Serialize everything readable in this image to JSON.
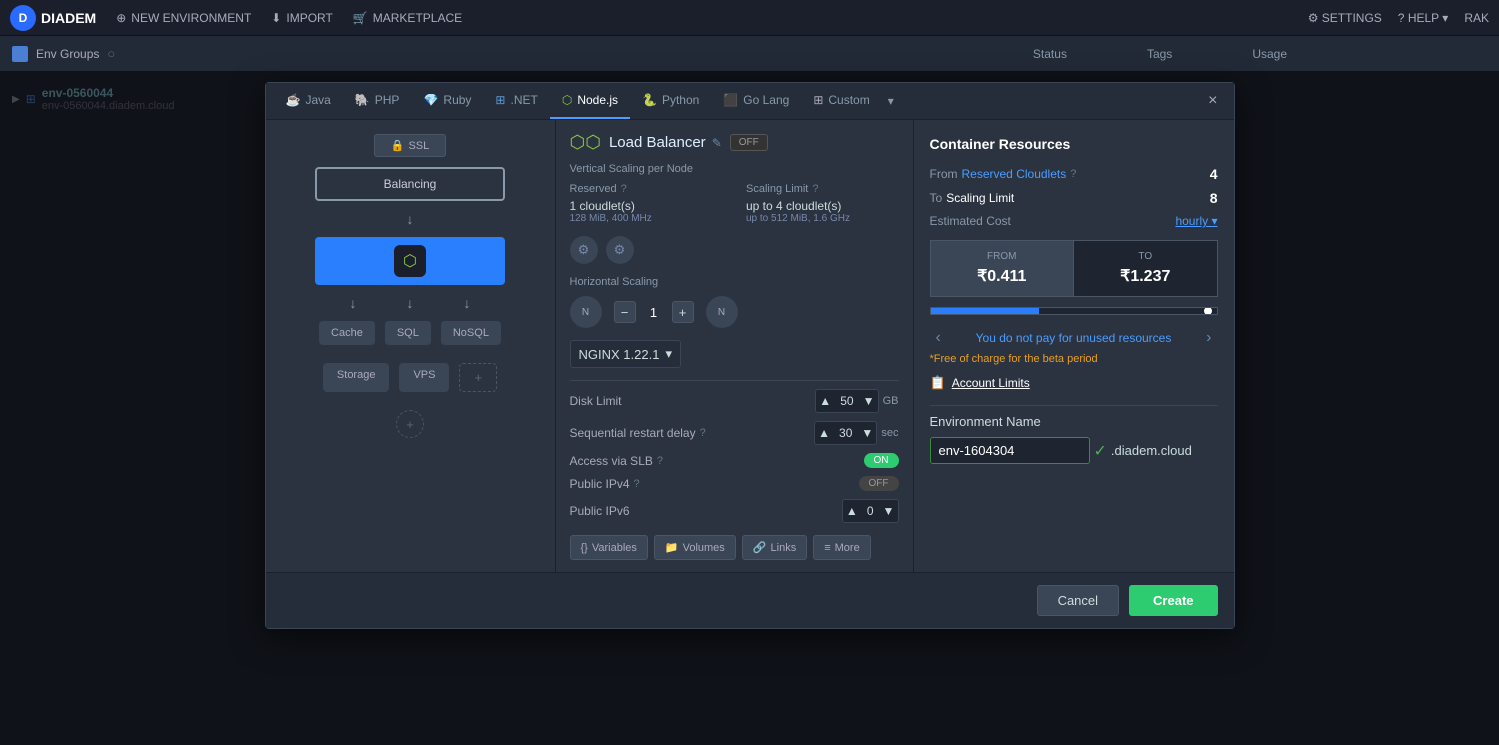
{
  "app": {
    "logo": "D",
    "brand": "DIADEM"
  },
  "topnav": {
    "items": [
      {
        "label": "NEW ENVIRONMENT",
        "icon": "plus-icon"
      },
      {
        "label": "IMPORT",
        "icon": "import-icon"
      },
      {
        "label": "MARKETPLACE",
        "icon": "marketplace-icon"
      }
    ],
    "right": [
      {
        "label": "SETTINGS",
        "icon": "settings-icon"
      },
      {
        "label": "HELP",
        "icon": "help-icon"
      },
      {
        "label": "RAK",
        "icon": "user-icon"
      }
    ]
  },
  "breadcrumb": {
    "group": "Env Groups",
    "columns": [
      "Status",
      "Tags",
      "Usage"
    ]
  },
  "sidebar": {
    "env_name": "env-0560044",
    "env_url": "env-0560044.diadem.cloud"
  },
  "modal": {
    "tabs": [
      {
        "label": "Java",
        "icon": "☕",
        "active": false
      },
      {
        "label": "PHP",
        "icon": "🐘",
        "active": false
      },
      {
        "label": "Ruby",
        "icon": "💎",
        "active": false
      },
      {
        "label": ".NET",
        "icon": "⊞",
        "active": false
      },
      {
        "label": "Node.js",
        "icon": "⬡",
        "active": true
      },
      {
        "label": "Python",
        "icon": "🐍",
        "active": false
      },
      {
        "label": "Go Lang",
        "icon": "🐹",
        "active": false
      },
      {
        "label": "Custom",
        "icon": "⊞",
        "active": false
      }
    ],
    "close_label": "×",
    "topology": {
      "ssl_label": "SSL",
      "balancing_label": "Balancing",
      "node_icon": "⬡",
      "db_items": [
        "Cache",
        "SQL",
        "NoSQL"
      ],
      "storage_items": [
        "Storage",
        "VPS"
      ],
      "add_more": "+"
    },
    "config": {
      "load_balancer_title": "Load Balancer",
      "edit_icon": "✎",
      "toggle_label": "OFF",
      "vertical_scaling_label": "Vertical Scaling per Node",
      "reserved_label": "Reserved",
      "reserved_help": "?",
      "scaling_limit_label": "Scaling Limit",
      "scaling_limit_help": "?",
      "reserved_val": "1",
      "reserved_unit": "cloudlet(s)",
      "reserved_sub": "128 MiB, 400 MHz",
      "scaling_val": "up to 4",
      "scaling_unit": "cloudlet(s)",
      "scaling_sub": "up to 512 MiB, 1.6 GHz",
      "horizontal_scaling_label": "Horizontal Scaling",
      "hz_count": "1",
      "nginx_version": "NGINX 1.22.1",
      "disk_limit_label": "Disk Limit",
      "disk_limit_val": "50",
      "disk_limit_unit": "GB",
      "seq_restart_label": "Sequential restart delay",
      "seq_restart_help": "?",
      "seq_restart_val": "30",
      "seq_restart_unit": "sec",
      "access_slb_label": "Access via SLB",
      "access_slb_help": "?",
      "access_slb_toggle": "ON",
      "public_ipv4_label": "Public IPv4",
      "public_ipv4_help": "?",
      "public_ipv4_toggle": "OFF",
      "public_ipv6_label": "Public IPv6",
      "public_ipv6_val": "0",
      "tools": [
        "Variables",
        "Volumes",
        "Links",
        "More"
      ]
    },
    "resources": {
      "title": "Container Resources",
      "from_label": "From",
      "reserved_cloudlets_label": "Reserved Cloudlets",
      "reserved_cloudlets_val": "4",
      "to_label": "To",
      "scaling_limit_label": "Scaling Limit",
      "scaling_limit_val": "8",
      "estimated_label": "Estimated Cost",
      "hourly_label": "hourly",
      "from_cost_label": "FROM",
      "from_cost_val": "₹0.411",
      "to_cost_label": "TO",
      "to_cost_val": "₹1.237",
      "unused_text": "You do not pay for unused resources",
      "free_notice": "*Free of charge for the beta period",
      "account_limits_label": "Account Limits",
      "env_name_label": "Environment Name",
      "env_name_val": "env-1604304",
      "env_domain": ".diadem.cloud"
    },
    "footer": {
      "cancel_label": "Cancel",
      "create_label": "Create"
    }
  }
}
